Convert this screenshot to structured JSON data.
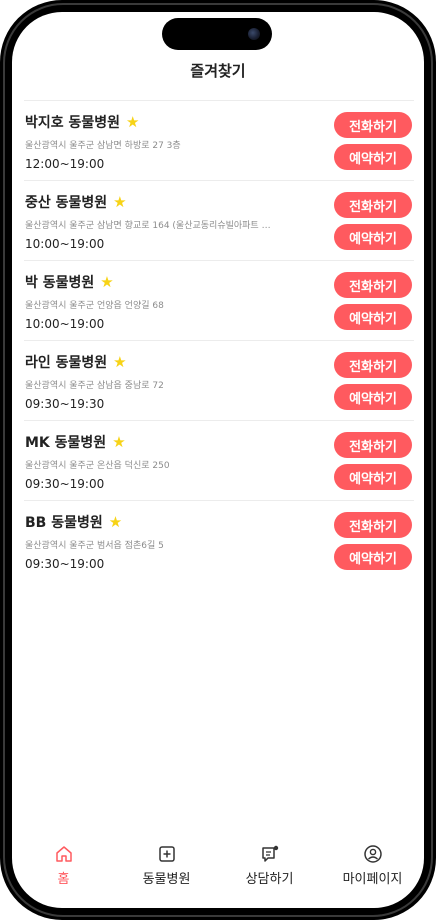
{
  "header": {
    "title": "즐겨찾기"
  },
  "favorites": [
    {
      "name": "박지호 동물병원",
      "address": "울산광역시 울주군 삼남면 하방로 27 3층",
      "hours": "12:00~19:00"
    },
    {
      "name": "중산 동물병원",
      "address": "울산광역시 울주군 삼남면 향교로 164 (울산교동리슈빌아파트 …",
      "hours": "10:00~19:00"
    },
    {
      "name": "박 동물병원",
      "address": "울산광역시 울주군 언양읍 언양길 68",
      "hours": "10:00~19:00"
    },
    {
      "name": "라인 동물병원",
      "address": "울산광역시 울주군 삼남읍 중남로 72",
      "hours": "09:30~19:30"
    },
    {
      "name": "MK 동물병원",
      "address": "울산광역시 울주군 온산읍 덕신로 250",
      "hours": "09:30~19:00"
    },
    {
      "name": "BB 동물병원",
      "address": "울산광역시 울주군 범서읍 점촌6길 5",
      "hours": "09:30~19:00"
    }
  ],
  "actions": {
    "call_label": "전화하기",
    "book_label": "예약하기"
  },
  "icons": {
    "favorite": "star-icon",
    "home": "home-icon",
    "hospital": "plus-square-icon",
    "consult": "chat-icon",
    "mypage": "user-circle-icon"
  },
  "tabbar": {
    "items": [
      {
        "label": "홈",
        "active": true
      },
      {
        "label": "동물병원",
        "active": false
      },
      {
        "label": "상담하기",
        "active": false
      },
      {
        "label": "마이페이지",
        "active": false
      }
    ]
  },
  "colors": {
    "accent": "#ff5a5f",
    "star": "#f7d316",
    "text": "#222222",
    "muted": "#8c8c8c"
  }
}
